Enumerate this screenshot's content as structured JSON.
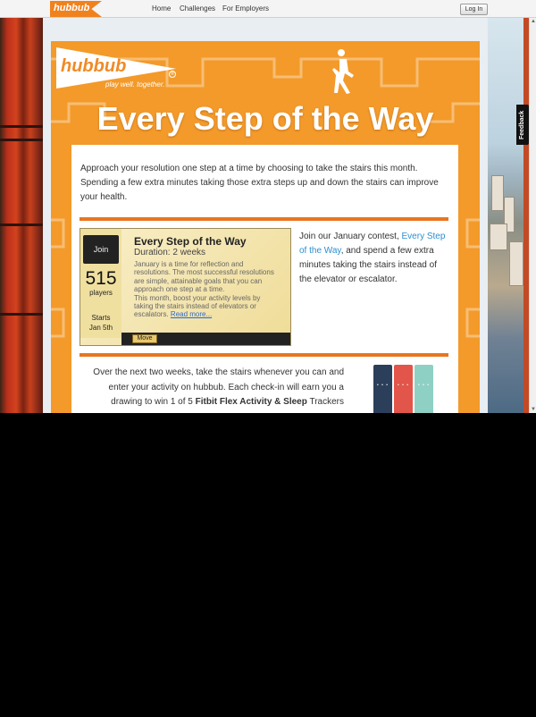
{
  "topnav": {
    "logo": "hubbub",
    "links": [
      "Home",
      "Challenges",
      "For Employers"
    ],
    "login": "Log In"
  },
  "feedback": "Feedback",
  "banner": {
    "logo": "hubbub",
    "registered": "®",
    "tagline": "play well. together.",
    "headline": "Every Step of the Way"
  },
  "intro": "Approach your resolution one step at a time by choosing to take the stairs this month. Spending a few extra minutes taking those extra steps up and down the stairs can improve your health.",
  "card": {
    "join": "Join",
    "players_count": "515",
    "players_label": "players",
    "starts_line1": "Starts",
    "starts_line2": "Jan 5th",
    "title": "Every Step of the Way",
    "duration": "Duration: 2 weeks",
    "desc1": "January is a time for reflection and resolutions. The most successful resolutions are simple, attainable goals that you can approach one step at a time.",
    "desc2": "This month, boost your activity levels by taking the stairs instead of elevators or escalators.",
    "read_more": "Read more...",
    "move": "Move"
  },
  "side": {
    "before": "Join our January contest,",
    "link": "Every Step of the Way",
    "after": ", and spend a few extra minutes taking the stairs instead of the elevator or escalator."
  },
  "bottom": {
    "text": "Over the next two weeks, take the stairs whenever you can and enter your activity on hubbub. Each check-in will earn you a drawing to win 1 of 5",
    "bold": "Fitbit Flex Activity & Sleep",
    "cut": "Trackers"
  },
  "colors": {
    "orange": "#f39a2a",
    "divider": "#e8761f",
    "link": "#2a8fd0",
    "bands": [
      "#2b3f5a",
      "#e2554a",
      "#8fd0c4"
    ]
  }
}
